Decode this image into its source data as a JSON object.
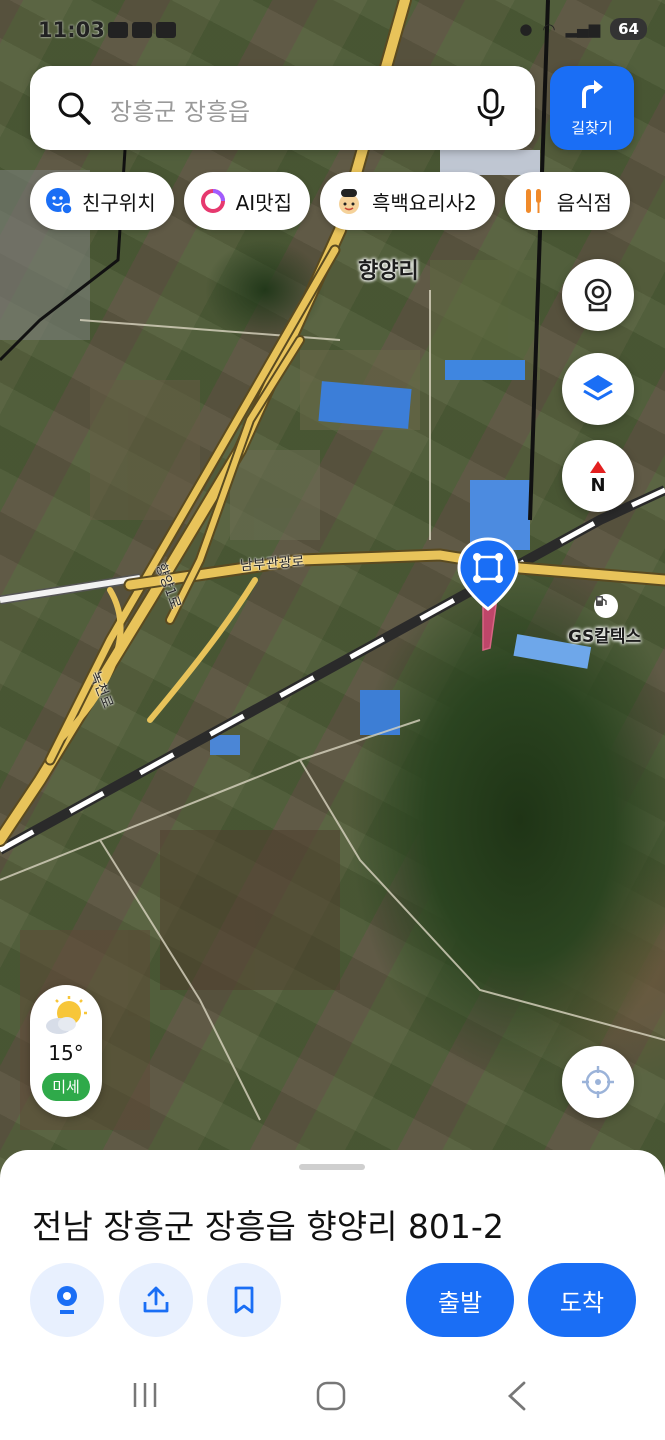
{
  "status_bar": {
    "time": "11:03",
    "battery": "64"
  },
  "search": {
    "placeholder": "장흥군 장흥읍",
    "icon": "search-icon",
    "mic_icon": "microphone-icon"
  },
  "route_button": {
    "label": "길찾기",
    "icon": "turn-right-arrow-icon"
  },
  "chips": [
    {
      "label": "친구위치",
      "icon": "friend-location-icon"
    },
    {
      "label": "AI맛집",
      "icon": "ai-ring-icon"
    },
    {
      "label": "흑백요리사2",
      "icon": "chef-icon"
    },
    {
      "label": "음식점",
      "icon": "utensils-icon"
    }
  ],
  "map": {
    "place_label": "향양리",
    "road_main": "남부관광로",
    "road_ramp": "향양1로",
    "road_side": "녹천로",
    "station_label": "GS칼텍스"
  },
  "controls": {
    "compass": "N",
    "street_view_icon": "street-view-icon",
    "layers_icon": "layers-icon",
    "locate_icon": "locate-crosshair-icon"
  },
  "weather": {
    "temperature": "15°",
    "dust": "미세",
    "icon": "sun-cloud-icon"
  },
  "sheet": {
    "address": "전남 장흥군 장흥읍 향양리 801-2",
    "depart_label": "출발",
    "arrive_label": "도착"
  },
  "colors": {
    "accent": "#1a6ef5",
    "dust_good": "#2faa4a",
    "road": "#e8c35a"
  }
}
